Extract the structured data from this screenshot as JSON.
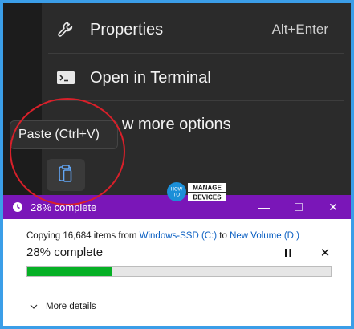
{
  "context_menu": {
    "items": [
      {
        "label": "Properties",
        "shortcut": "Alt+Enter",
        "icon": "wrench-icon"
      },
      {
        "label": "Open in Terminal",
        "icon": "terminal-icon"
      },
      {
        "label": "Show more options",
        "visible_label": "w more options",
        "icon": "more-options-icon"
      }
    ]
  },
  "tooltip": {
    "text": "Paste (Ctrl+V)"
  },
  "paste_button": {
    "icon": "clipboard-icon"
  },
  "logo": {
    "line1": "HOW",
    "line2": "TO",
    "word1": "MANAGE",
    "word2": "DEVICES"
  },
  "copy_dialog": {
    "title": "28% complete",
    "copy_prefix": "Copying 16,684 items from ",
    "source": "Windows-SSD (C:)",
    "to_word": " to ",
    "destination": "New Volume (D:)",
    "percent_label": "28% complete",
    "progress": 0.28,
    "more_details": "More details",
    "colors": {
      "titlebar": "#7a16b8",
      "progress": "#06b025",
      "link": "#0a5fc2"
    }
  }
}
